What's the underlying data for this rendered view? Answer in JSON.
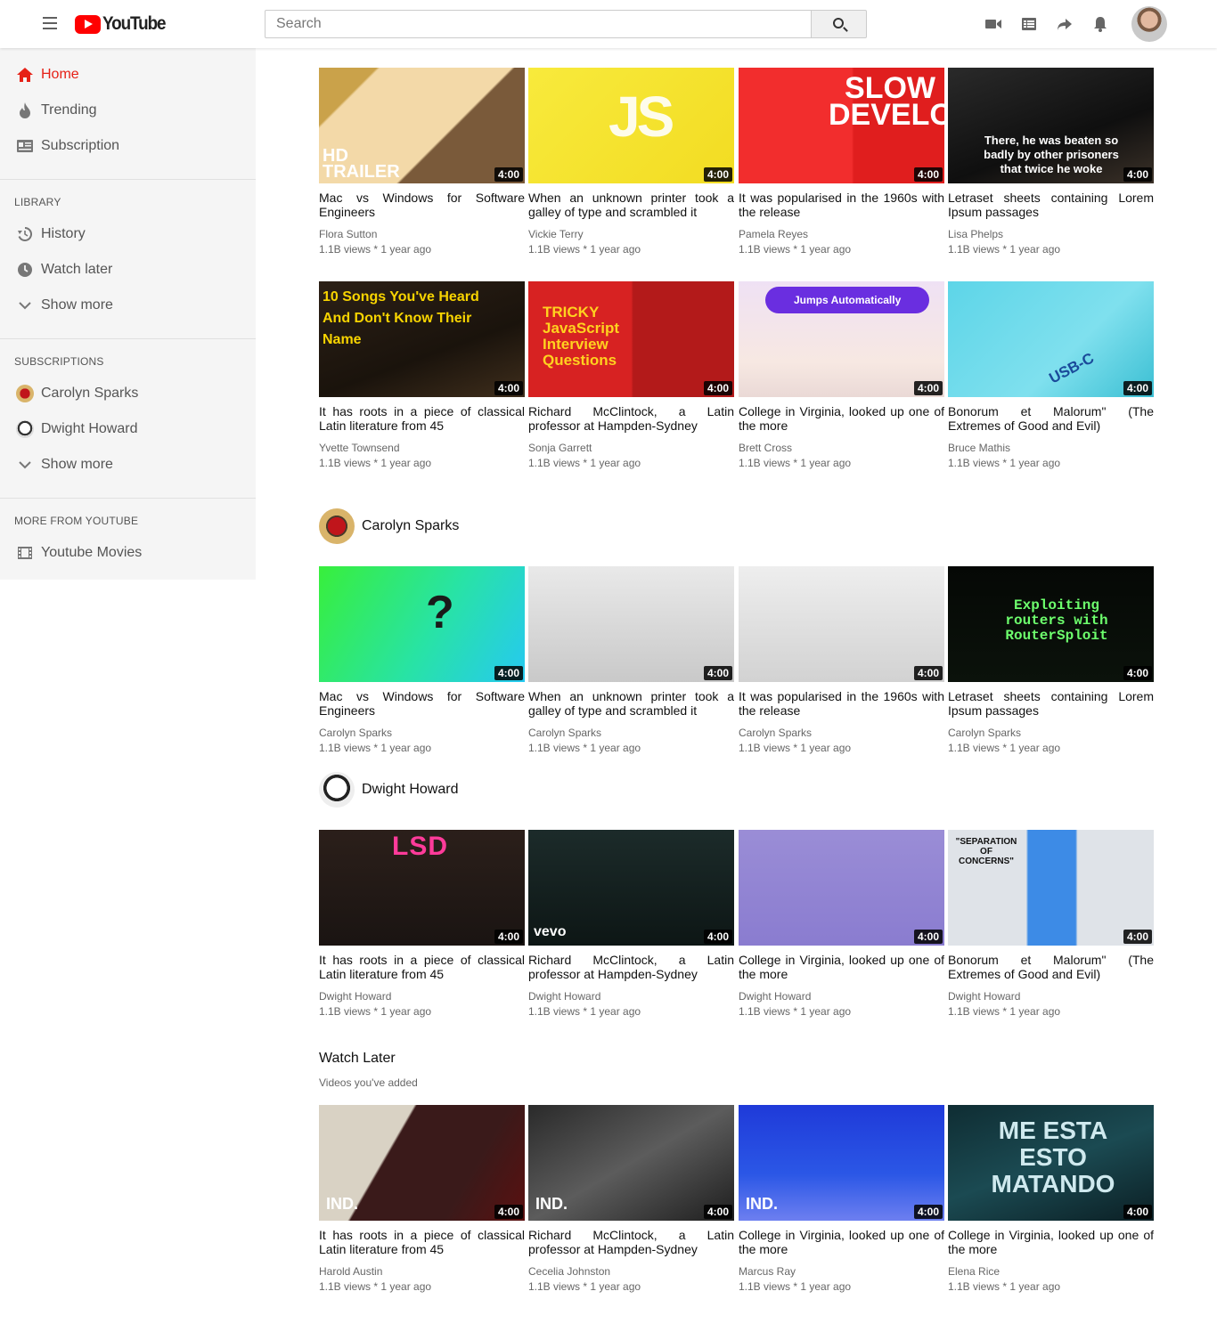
{
  "header": {
    "logo_text": "YouTube",
    "search_placeholder": "Search"
  },
  "sidebar": {
    "main": [
      {
        "label": "Home",
        "icon": "home-icon",
        "active": true
      },
      {
        "label": "Trending",
        "icon": "flame-icon"
      },
      {
        "label": "Subscription",
        "icon": "subscriptions-icon"
      }
    ],
    "library_heading": "LIBRARY",
    "library": [
      {
        "label": "History",
        "icon": "history-icon"
      },
      {
        "label": "Watch later",
        "icon": "clock-icon"
      },
      {
        "label": "Show more",
        "icon": "chevron-down-icon"
      }
    ],
    "subscriptions_heading": "SUBSCRIPTIONS",
    "subscriptions": [
      {
        "label": "Carolyn Sparks"
      },
      {
        "label": "Dwight Howard"
      },
      {
        "label": "Show more",
        "icon": "chevron-down-icon"
      }
    ],
    "more_heading": "MORE FROM YOUTUBE",
    "more": [
      {
        "label": "Youtube Movies",
        "icon": "film-icon"
      }
    ]
  },
  "rows": [
    [
      {
        "title": "Mac vs Windows for Software Engineers",
        "channel": "Flora Sutton",
        "meta": "1.1B views * 1 year ago",
        "duration": "4:00",
        "overlay": "HD TRAILER"
      },
      {
        "title": "When an unknown printer took a galley of type and scrambled it",
        "channel": "Vickie Terry",
        "meta": "1.1B views * 1 year ago",
        "duration": "4:00",
        "overlay": "JS"
      },
      {
        "title": "It was popularised in the 1960s with the release",
        "channel": "Pamela Reyes",
        "meta": "1.1B views * 1 year ago",
        "duration": "4:00",
        "overlay": "SLOW DEVELOPER"
      },
      {
        "title": "Letraset sheets containing Lorem Ipsum passages",
        "channel": "Lisa Phelps",
        "meta": "1.1B views * 1 year ago",
        "duration": "4:00",
        "overlay": "There, he was beaten so badly by other prisoners that twice he woke"
      }
    ],
    [
      {
        "title": "It has roots in a piece of classical Latin literature from 45",
        "channel": "Yvette Townsend",
        "meta": "1.1B views * 1 year ago",
        "duration": "4:00",
        "overlay": "10 Songs You've Heard And Don't Know Their Name"
      },
      {
        "title": "Richard McClintock, a Latin professor at Hampden-Sydney",
        "channel": "Sonja Garrett",
        "meta": "1.1B views * 1 year ago",
        "duration": "4:00",
        "overlay": "TRICKY JavaScript Interview Questions"
      },
      {
        "title": "College in Virginia, looked up one of the more",
        "channel": "Brett Cross",
        "meta": "1.1B views * 1 year ago",
        "duration": "4:00",
        "overlay": "Jumps Automatically"
      },
      {
        "title": "Bonorum et Malorum\" (The Extremes of Good and Evil)",
        "channel": "Bruce Mathis",
        "meta": "1.1B views * 1 year ago",
        "duration": "4:00",
        "overlay": "USB-C"
      }
    ],
    [
      {
        "title": "Mac vs Windows for Software Engineers",
        "channel": "Carolyn Sparks",
        "meta": "1.1B views * 1 year ago",
        "duration": "4:00",
        "overlay": "?"
      },
      {
        "title": "When an unknown printer took a galley of type and scrambled it",
        "channel": "Carolyn Sparks",
        "meta": "1.1B views * 1 year ago",
        "duration": "4:00",
        "overlay": ""
      },
      {
        "title": "It was popularised in the 1960s with the release",
        "channel": "Carolyn Sparks",
        "meta": "1.1B views * 1 year ago",
        "duration": "4:00",
        "overlay": ""
      },
      {
        "title": "Letraset sheets containing Lorem Ipsum passages",
        "channel": "Carolyn Sparks",
        "meta": "1.1B views * 1 year ago",
        "duration": "4:00",
        "overlay": "Exploiting routers with RouterSploit"
      }
    ],
    [
      {
        "title": "It has roots in a piece of classical Latin literature from 45",
        "channel": "Dwight Howard",
        "meta": "1.1B views * 1 year ago",
        "duration": "4:00",
        "overlay": "LSD"
      },
      {
        "title": "Richard McClintock, a Latin professor at Hampden-Sydney",
        "channel": "Dwight Howard",
        "meta": "1.1B views * 1 year ago",
        "duration": "4:00",
        "overlay": "vevo"
      },
      {
        "title": "College in Virginia, looked up one of the more",
        "channel": "Dwight Howard",
        "meta": "1.1B views * 1 year ago",
        "duration": "4:00",
        "overlay": ""
      },
      {
        "title": "Bonorum et Malorum\" (The Extremes of Good and Evil)",
        "channel": "Dwight Howard",
        "meta": "1.1B views * 1 year ago",
        "duration": "4:00",
        "overlay": "\"SEPARATION OF CONCERNS\""
      }
    ],
    [
      {
        "title": "It has roots in a piece of classical Latin literature from 45",
        "channel": "Harold Austin",
        "meta": "1.1B views * 1 year ago",
        "duration": "4:00",
        "overlay": "IND."
      },
      {
        "title": "Richard McClintock, a Latin professor at Hampden-Sydney",
        "channel": "Cecelia Johnston",
        "meta": "1.1B views * 1 year ago",
        "duration": "4:00",
        "overlay": "IND."
      },
      {
        "title": "College in Virginia, looked up one of the more",
        "channel": "Marcus Ray",
        "meta": "1.1B views * 1 year ago",
        "duration": "4:00",
        "overlay": "IND."
      },
      {
        "title": "College in Virginia, looked up one of the more",
        "channel": "Elena Rice",
        "meta": "1.1B views * 1 year ago",
        "duration": "4:00",
        "overlay": "ME ESTA ESTO MATANDO"
      }
    ]
  ],
  "sections": {
    "carolyn": {
      "name": "Carolyn Sparks"
    },
    "dwight": {
      "name": "Dwight Howard"
    },
    "watch_later": {
      "title": "Watch Later",
      "subtitle": "Videos you've added"
    }
  },
  "colors": {
    "accent": "#e62117",
    "brand": "#ff0000"
  }
}
